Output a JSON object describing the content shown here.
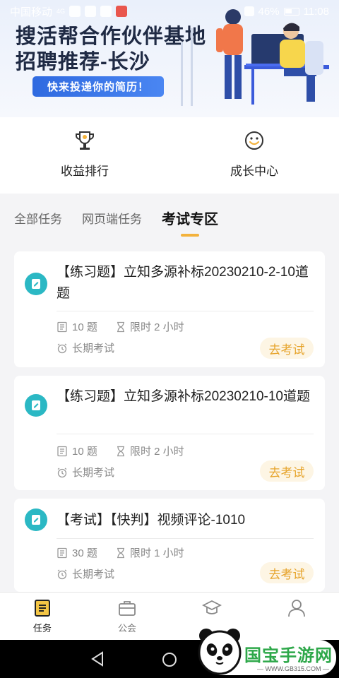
{
  "status_bar": {
    "carrier": "中国移动",
    "network": "4G",
    "battery": "46%",
    "time": "11:08"
  },
  "banner": {
    "title_line1": "搜活帮合作伙伴基地",
    "title_line2": "招聘推荐-长沙",
    "cta": "快来投递你的简历！"
  },
  "quick_entries": [
    {
      "label": "收益排行",
      "icon": "trophy-icon"
    },
    {
      "label": "成长中心",
      "icon": "smiley-icon"
    }
  ],
  "tabs": [
    {
      "label": "全部任务",
      "active": false
    },
    {
      "label": "网页端任务",
      "active": false
    },
    {
      "label": "考试专区",
      "active": true
    }
  ],
  "tasks": [
    {
      "title": "【练习题】立知多源补标20230210-2-10道题",
      "questions": "10 题",
      "time_limit": "限时 2 小时",
      "period": "长期考试",
      "action": "去考试"
    },
    {
      "title": "【练习题】立知多源补标20230210-10道题",
      "questions": "10 题",
      "time_limit": "限时 2 小时",
      "period": "长期考试",
      "action": "去考试"
    },
    {
      "title": "【考试】【快判】视频评论-1010",
      "questions": "30 题",
      "time_limit": "限时 1 小时",
      "period": "长期考试",
      "action": "去考试"
    }
  ],
  "bottom_nav": [
    {
      "label": "任务",
      "icon": "task-list-icon",
      "active": true
    },
    {
      "label": "公会",
      "icon": "briefcase-icon",
      "active": false
    },
    {
      "label": "",
      "icon": "graduation-cap-icon",
      "active": false
    },
    {
      "label": "",
      "icon": "person-icon",
      "active": false
    }
  ],
  "watermark": {
    "brand": "国宝手游网",
    "url": "— WWW.GB315.COM —"
  },
  "colors": {
    "accent": "#f3b23c",
    "teal": "#2bb8c4",
    "go_text": "#e6a32a",
    "go_bg": "#fdf5e4",
    "cta_blue": "#2f6ae0"
  }
}
